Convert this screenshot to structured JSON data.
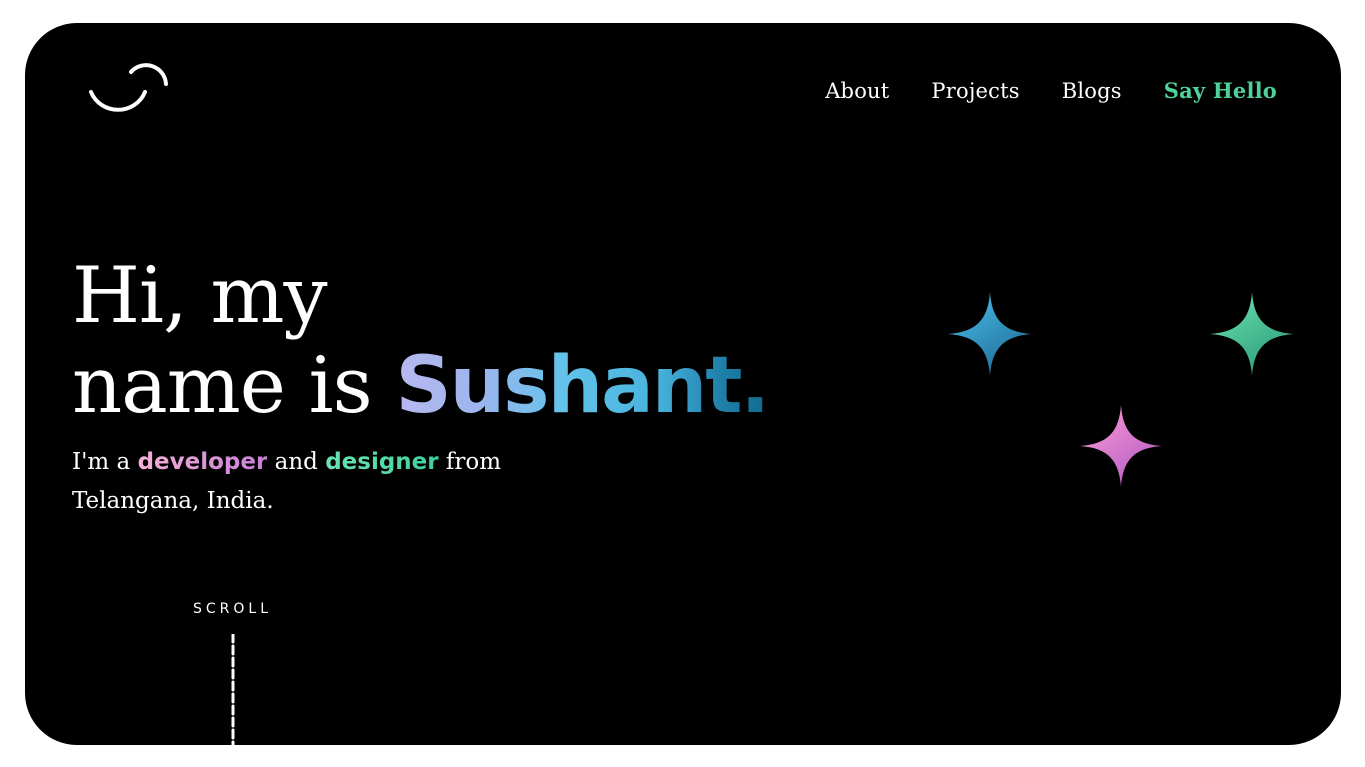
{
  "nav": {
    "about": "About",
    "projects": "Projects",
    "blogs": "Blogs",
    "say_hello": "Say Hello"
  },
  "hero": {
    "line1": "Hi, my",
    "line2_prefix": "name is ",
    "name": "Sushant."
  },
  "tagline": {
    "part1": "I'm a ",
    "developer": "developer",
    "part2": " and ",
    "designer": "designer",
    "part3": " from",
    "location": "Telangana, India."
  },
  "scroll": {
    "label": "SCROLL"
  },
  "icons": {
    "logo": "smile-logo-icon",
    "sparkle_blue": "sparkle-icon",
    "sparkle_green": "sparkle-icon",
    "sparkle_pink": "sparkle-icon"
  },
  "colors": {
    "background": "#000000",
    "accent_green": "#4fd19a",
    "name_gradient_start": "#b8b9f0",
    "name_gradient_end": "#0f6b8f",
    "developer_pink": "#e49ad6",
    "sparkle_blue": "#3aa6d6",
    "sparkle_green": "#4fd19a",
    "sparkle_pink": "#f08ad0"
  }
}
